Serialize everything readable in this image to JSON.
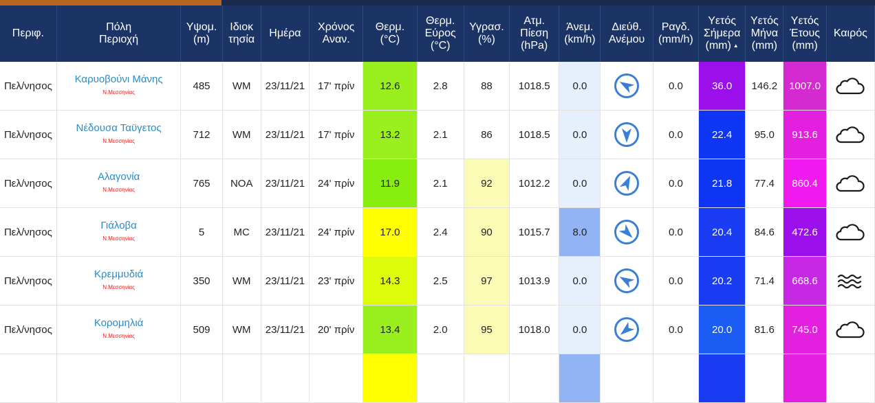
{
  "colors": {
    "header_bg": "#1c3366",
    "topbar": "#1a2a4a",
    "accent": "#b5651d",
    "city_link": "#2a8bc9",
    "prefecture": "#e11d1d",
    "wind_icon": "#3a7fd5"
  },
  "headers": [
    {
      "key": "region",
      "lines": [
        "Περιφ."
      ]
    },
    {
      "key": "city",
      "lines": [
        "Πόλη",
        "Περιοχή"
      ]
    },
    {
      "key": "altitude",
      "lines": [
        "Υψομ.",
        "(m)"
      ]
    },
    {
      "key": "owner",
      "lines": [
        "Ιδιοκ",
        "τησία"
      ]
    },
    {
      "key": "date",
      "lines": [
        "Ημέρα"
      ]
    },
    {
      "key": "updated",
      "lines": [
        "Χρόνος",
        "Αναν."
      ]
    },
    {
      "key": "temp",
      "lines": [
        "Θερμ.",
        "(°C)"
      ]
    },
    {
      "key": "temp_range",
      "lines": [
        "Θερμ.",
        "Εύρος",
        "(°C)"
      ]
    },
    {
      "key": "humidity",
      "lines": [
        "Υγρασ.",
        "(%)"
      ]
    },
    {
      "key": "pressure",
      "lines": [
        "Ατμ.",
        "Πίεση",
        "(hPa)"
      ]
    },
    {
      "key": "wind",
      "lines": [
        "Άνεμ.",
        "(km/h)"
      ]
    },
    {
      "key": "wind_dir",
      "lines": [
        "Διεύθ.",
        "Ανέμου"
      ]
    },
    {
      "key": "rain_rate",
      "lines": [
        "Ραγδ.",
        "(mm/h)"
      ]
    },
    {
      "key": "rain_today",
      "lines": [
        "Υετός",
        "Σήμερα",
        "(mm)"
      ],
      "sorted": true
    },
    {
      "key": "rain_month",
      "lines": [
        "Υετός",
        "Μήνα",
        "(mm)"
      ]
    },
    {
      "key": "rain_year",
      "lines": [
        "Υετός",
        "Έτους",
        "(mm)"
      ]
    },
    {
      "key": "weather",
      "lines": [
        "Καιρός"
      ]
    }
  ],
  "sort_indicator": "▲",
  "rows": [
    {
      "region": "Πελ/νησος",
      "city": "Καρυοβούνι Μάνης",
      "prefecture": "Ν.Μεσσηνίας",
      "altitude": "485",
      "owner": "WM",
      "date": "23/11/21",
      "updated": "17' πρίν",
      "temp": "12.6",
      "temp_range": "2.8",
      "humidity": "88",
      "pressure": "1018.5",
      "wind": "0.0",
      "wind_dir_deg": 300,
      "rain_rate": "0.0",
      "rain_today": "36.0",
      "rain_month": "146.2",
      "rain_year": "1007.0",
      "weather": "cloud-icon",
      "cell_colors": {
        "temp": "#9aef1f",
        "humidity": "#ffffff",
        "wind": "#e6f0fc",
        "rain_today": "#9b10ea",
        "rain_year": "#d52ad1"
      }
    },
    {
      "region": "Πελ/νησος",
      "city": "Νέδουσα Ταϋγετος",
      "prefecture": "Ν.Μεσσηνίας",
      "altitude": "712",
      "owner": "WM",
      "date": "23/11/21",
      "updated": "17' πρίν",
      "temp": "13.2",
      "temp_range": "2.1",
      "humidity": "86",
      "pressure": "1018.5",
      "wind": "0.0",
      "wind_dir_deg": 180,
      "rain_rate": "0.0",
      "rain_today": "22.4",
      "rain_month": "95.0",
      "rain_year": "913.6",
      "weather": "cloud-icon",
      "cell_colors": {
        "temp": "#9aef1f",
        "humidity": "#ffffff",
        "wind": "#e6f0fc",
        "rain_today": "#0f35f5",
        "rain_year": "#e320e0"
      }
    },
    {
      "region": "Πελ/νησος",
      "city": "Αλαγονία",
      "prefecture": "Ν.Μεσσηνίας",
      "altitude": "765",
      "owner": "NOA",
      "date": "23/11/21",
      "updated": "24' πρίν",
      "temp": "11.9",
      "temp_range": "2.1",
      "humidity": "92",
      "pressure": "1012.2",
      "wind": "0.0",
      "wind_dir_deg": 25,
      "rain_rate": "0.0",
      "rain_today": "21.8",
      "rain_month": "77.4",
      "rain_year": "860.4",
      "weather": "cloud-icon",
      "cell_colors": {
        "temp": "#88ee10",
        "humidity": "#fbfbb6",
        "wind": "#e6f0fc",
        "rain_today": "#0f35f5",
        "rain_year": "#f019f0"
      }
    },
    {
      "region": "Πελ/νησος",
      "city": "Γιάλοβα",
      "prefecture": "Ν.Μεσσηνίας",
      "altitude": "5",
      "owner": "MC",
      "date": "23/11/21",
      "updated": "24' πρίν",
      "temp": "17.0",
      "temp_range": "2.4",
      "humidity": "90",
      "pressure": "1015.7",
      "wind": "8.0",
      "wind_dir_deg": 135,
      "rain_rate": "0.0",
      "rain_today": "20.4",
      "rain_month": "84.6",
      "rain_year": "472.6",
      "weather": "cloud-icon",
      "cell_colors": {
        "temp": "#ffff00",
        "humidity": "#fbfbb6",
        "wind": "#93b4f4",
        "rain_today": "#1a3cf2",
        "rain_year": "#9b10ea"
      }
    },
    {
      "region": "Πελ/νησος",
      "city": "Κρεμμυδιά",
      "prefecture": "Ν.Μεσσηνίας",
      "altitude": "350",
      "owner": "WM",
      "date": "23/11/21",
      "updated": "23' πρίν",
      "temp": "14.3",
      "temp_range": "2.5",
      "humidity": "97",
      "pressure": "1013.9",
      "wind": "0.0",
      "wind_dir_deg": 300,
      "rain_rate": "0.0",
      "rain_today": "20.2",
      "rain_month": "71.4",
      "rain_year": "668.6",
      "weather": "fog-icon",
      "cell_colors": {
        "temp": "#dcfc0a",
        "humidity": "#fbfbb6",
        "wind": "#e6f0fc",
        "rain_today": "#1a3cf2",
        "rain_year": "#c628e3"
      }
    },
    {
      "region": "Πελ/νησος",
      "city": "Κορομηλιά",
      "prefecture": "Ν.Μεσσηνίας",
      "altitude": "509",
      "owner": "WM",
      "date": "23/11/21",
      "updated": "20' πρίν",
      "temp": "13.4",
      "temp_range": "2.0",
      "humidity": "95",
      "pressure": "1018.0",
      "wind": "0.0",
      "wind_dir_deg": 230,
      "rain_rate": "0.0",
      "rain_today": "20.0",
      "rain_month": "81.6",
      "rain_year": "745.0",
      "weather": "cloud-icon",
      "cell_colors": {
        "temp": "#9aef1f",
        "humidity": "#fbfbb6",
        "wind": "#e6f0fc",
        "rain_today": "#1a5cf4",
        "rain_year": "#e320e0"
      }
    },
    {
      "region": "",
      "city": "",
      "prefecture": "",
      "altitude": "",
      "owner": "",
      "date": "",
      "updated": "",
      "temp": "",
      "temp_range": "",
      "humidity": "",
      "pressure": "",
      "wind": "",
      "wind_dir_deg": null,
      "rain_rate": "",
      "rain_today": "",
      "rain_month": "",
      "rain_year": "",
      "weather": "",
      "cell_colors": {
        "temp": "#ffff00",
        "humidity": "#ffffff",
        "wind": "#93b4f4",
        "rain_today": "#1a3cf2",
        "rain_year": "#e320e0"
      }
    }
  ]
}
